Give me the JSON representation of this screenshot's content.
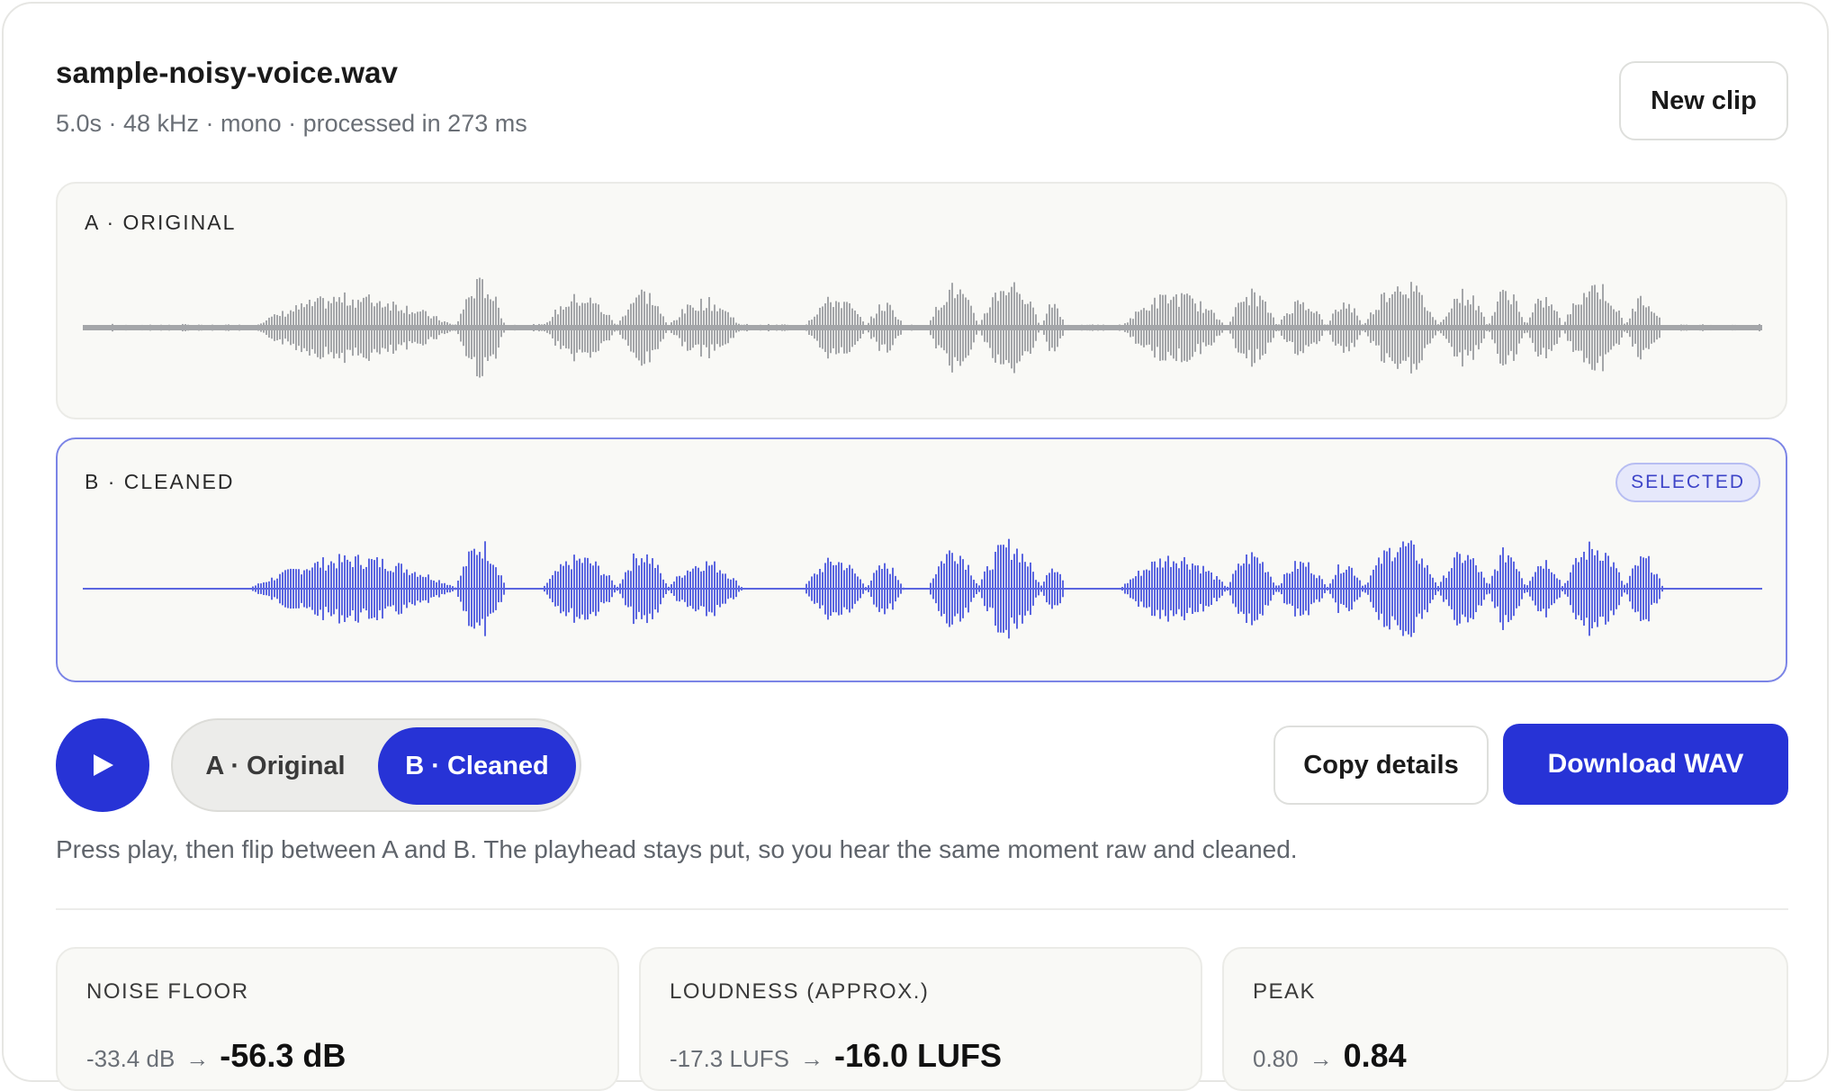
{
  "file": {
    "name": "sample-noisy-voice.wav",
    "meta": "5.0s · 48 kHz · mono · processed in 273 ms"
  },
  "actions": {
    "new_clip": "New clip",
    "copy_details": "Copy details",
    "download": "Download WAV"
  },
  "waveforms": {
    "original": {
      "label": "A · ORIGINAL",
      "color": "#a4a6a9"
    },
    "cleaned": {
      "label": "B · CLEANED",
      "badge": "SELECTED",
      "color": "#5b66e0"
    }
  },
  "playback": {
    "play_icon": "play-icon",
    "options": [
      "A · Original",
      "B · Cleaned"
    ],
    "selected": "B · Cleaned"
  },
  "hint": "Press play, then flip between A and B. The playhead stays put, so you hear the same moment raw and cleaned.",
  "stats": [
    {
      "label": "NOISE FLOOR",
      "before": "-33.4 dB",
      "after": "-56.3 dB"
    },
    {
      "label": "LOUDNESS (APPROX.)",
      "before": "-17.3 LUFS",
      "after": "-16.0 LUFS"
    },
    {
      "label": "PEAK",
      "before": "0.80",
      "after": "0.84"
    }
  ],
  "colors": {
    "accent": "#2733d6"
  }
}
